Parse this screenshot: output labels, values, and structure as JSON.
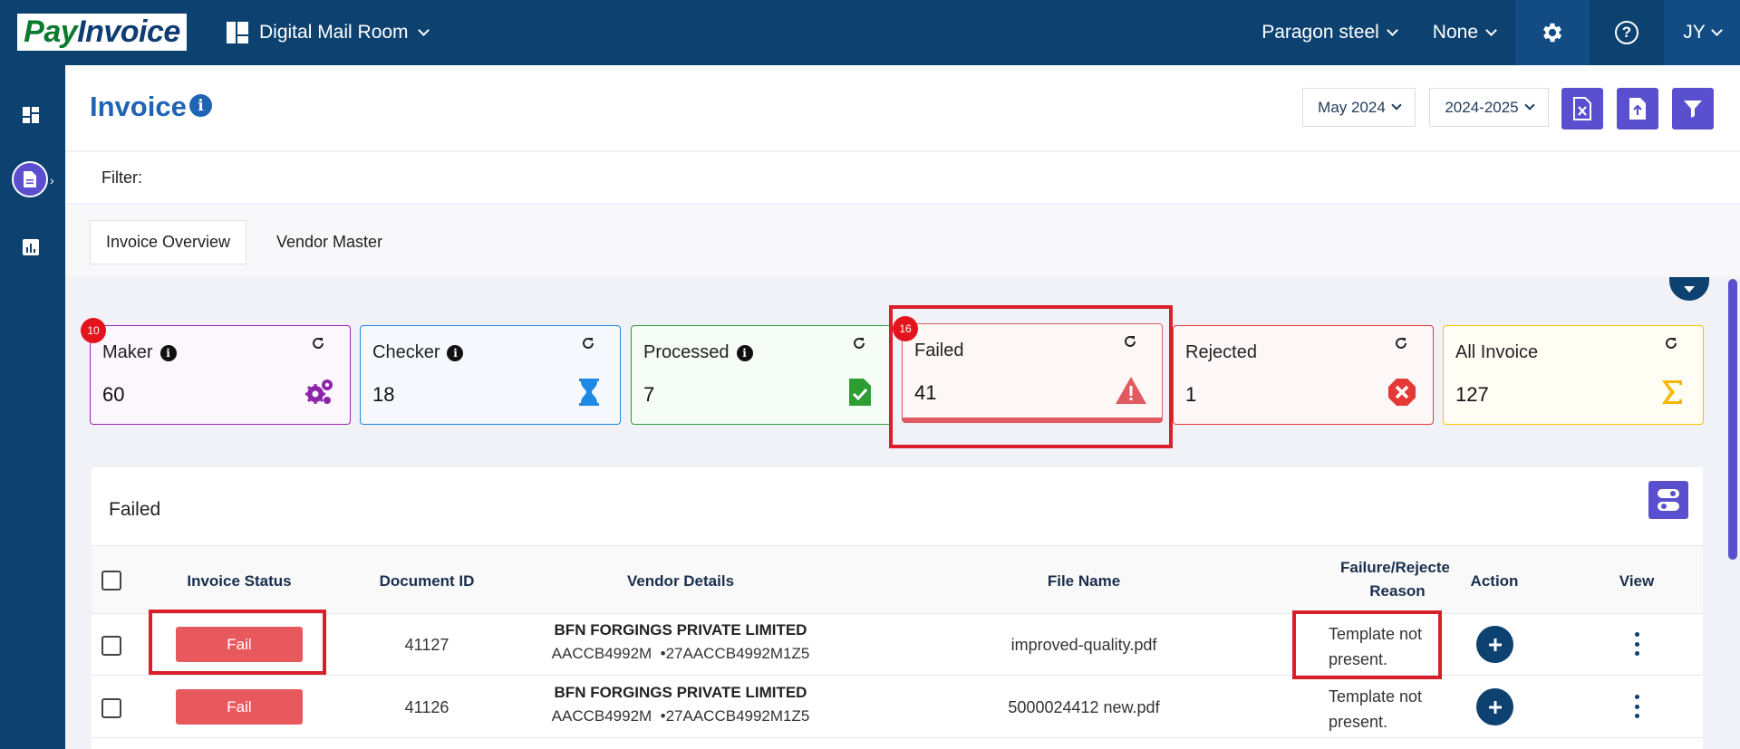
{
  "topbar": {
    "logo_part1": "Pay",
    "logo_part2": "Invoice",
    "app_name": "Digital Mail Room",
    "company": "Paragon steel",
    "entity": "None",
    "user_initials": "JY",
    "help_symbol": "?"
  },
  "header": {
    "title": "Invoice",
    "info_symbol": "i",
    "month_select": "May 2024",
    "year_select": "2024-2025"
  },
  "filter": {
    "label": "Filter:"
  },
  "tabs": [
    {
      "label": "Invoice Overview",
      "active": true
    },
    {
      "label": "Vendor Master",
      "active": false
    }
  ],
  "cards": [
    {
      "label": "Maker",
      "count": "60",
      "badge": "10",
      "has_info": true,
      "color": "#8e24aa",
      "icon": "gears-icon"
    },
    {
      "label": "Checker",
      "count": "18",
      "has_info": true,
      "color": "#1e88e5",
      "icon": "hourglass-icon"
    },
    {
      "label": "Processed",
      "count": "7",
      "has_info": true,
      "color": "#2e9e33",
      "icon": "file-check-icon"
    },
    {
      "label": "Failed",
      "count": "41",
      "badge": "16",
      "has_info": false,
      "color": "#e05a5f",
      "icon": "warning-icon"
    },
    {
      "label": "Rejected",
      "count": "1",
      "has_info": false,
      "color": "#e53935",
      "icon": "x-circle-icon"
    },
    {
      "label": "All Invoice",
      "count": "127",
      "has_info": false,
      "color": "#f5b800",
      "icon": "sigma-icon"
    }
  ],
  "table": {
    "title": "Failed",
    "headers": {
      "status": "Invoice Status",
      "doc_id": "Document ID",
      "vendor": "Vendor Details",
      "file": "File Name",
      "reason_line1": "Failure/Rejecte",
      "reason_line2": "Reason",
      "action": "Action",
      "view": "View"
    },
    "rows": [
      {
        "status": "Fail",
        "doc_id": "41127",
        "vendor_name": "BFN FORGINGS PRIVATE LIMITED",
        "vendor_ids": "AACCB4992M  •27AACCB4992M1Z5",
        "file": "improved-quality.pdf",
        "reason_line1": "Template not",
        "reason_line2": "present."
      },
      {
        "status": "Fail",
        "doc_id": "41126",
        "vendor_name": "BFN FORGINGS PRIVATE LIMITED",
        "vendor_ids": "AACCB4992M  •27AACCB4992M1Z5",
        "file": "5000024412 new.pdf",
        "reason_line1": "Template not",
        "reason_line2": "present."
      }
    ]
  },
  "colors": {
    "navy": "#0c4170",
    "accent_purple": "#5a4fcf",
    "title_blue": "#1e63b4",
    "fail_red": "#e8595e",
    "highlight_red": "#d91f2a"
  }
}
